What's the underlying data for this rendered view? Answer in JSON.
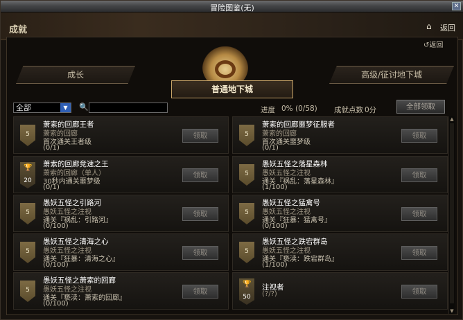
{
  "window": {
    "title": "冒险图鉴(无)"
  },
  "header": {
    "title": "成就",
    "return_label": "返回"
  },
  "subheader": {
    "return_label": "返回"
  },
  "tabs": {
    "growth": "成长",
    "normal": "普通地下城",
    "advanced": "高级/征讨地下城"
  },
  "filter": {
    "selected": "全部",
    "search_value": ""
  },
  "stats": {
    "progress_label": "进度",
    "progress_value": "0%",
    "progress_count": "(0/58)",
    "points_label": "成就点数",
    "points_value": "0分"
  },
  "claim_all_label": "全部领取",
  "claim_label": "领取",
  "achievements": [
    {
      "badge": "5",
      "title": "萧索的回廊王者",
      "sub": "萧索的回廊",
      "desc": "首次通关王者级",
      "progress": "(0/1)"
    },
    {
      "badge": "5",
      "title": "萧索的回廊噩梦征服者",
      "sub": "萧索的回廊",
      "desc": "首次通关噩梦级",
      "progress": "(0/1)"
    },
    {
      "badge": "20",
      "title": "萧索的回廊竞速之王",
      "sub": "萧索的回廊（单人）",
      "desc": "30秒内通关噩梦级",
      "progress": "(0/1)"
    },
    {
      "badge": "5",
      "title": "愚妖五怪之落星森林",
      "sub": "愚妖五怪之注视",
      "desc": "通关『祸乱：落星森林』",
      "progress": "(1/100)"
    },
    {
      "badge": "5",
      "title": "愚妖五怪之引路河",
      "sub": "愚妖五怪之注视",
      "desc": "通关『祸乱：引路河』",
      "progress": "(0/100)"
    },
    {
      "badge": "5",
      "title": "愚妖五怪之猛禽号",
      "sub": "愚妖五怪之注视",
      "desc": "通关『狂暴：猛禽号』",
      "progress": "(0/100)"
    },
    {
      "badge": "5",
      "title": "愚妖五怪之清海之心",
      "sub": "愚妖五怪之注视",
      "desc": "通关『狂暴：清海之心』",
      "progress": "(0/100)"
    },
    {
      "badge": "5",
      "title": "愚妖五怪之跌宕群岛",
      "sub": "愚妖五怪之注视",
      "desc": "通关『亵渎：跌宕群岛』",
      "progress": "(1/100)"
    },
    {
      "badge": "5",
      "title": "愚妖五怪之萧索的回廊",
      "sub": "愚妖五怪之注视",
      "desc": "通关『亵渎：萧索的回廊』",
      "progress": "(0/100)"
    },
    {
      "badge": "50",
      "title": "注视者",
      "sub": "(?/?)",
      "desc": "",
      "progress": ""
    }
  ]
}
